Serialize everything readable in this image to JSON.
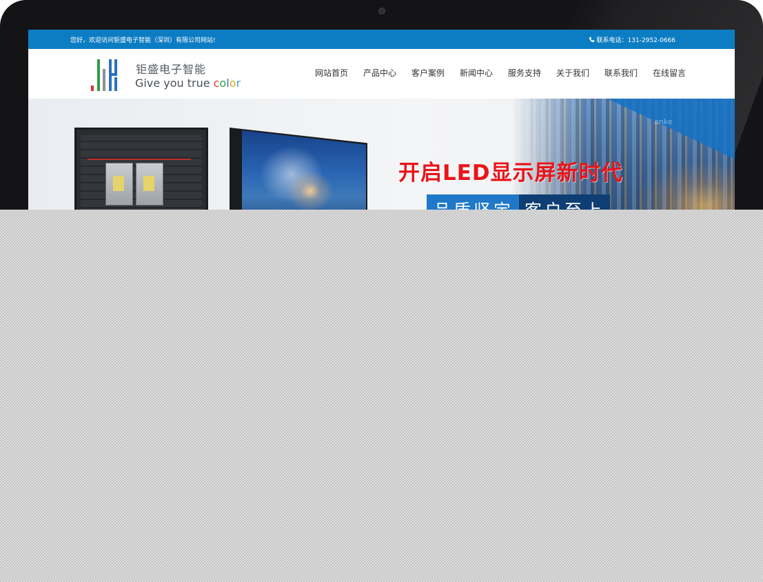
{
  "topbar": {
    "welcome": "您好，欢迎访问钜盛电子智能（深圳）有限公司网站!",
    "phone_label": "联系电话：131-2952-0666"
  },
  "header": {
    "brand_cn": "钜盛电子智能",
    "brand_en_prefix": "Give you true ",
    "brand_en_letters": [
      "c",
      "o",
      "l",
      "o",
      "r"
    ]
  },
  "nav": {
    "items": [
      {
        "label": "网站首页"
      },
      {
        "label": "产品中心"
      },
      {
        "label": "客户案例"
      },
      {
        "label": "新闻中心"
      },
      {
        "label": "服务支持"
      },
      {
        "label": "关于我们"
      },
      {
        "label": "联系我们"
      },
      {
        "label": "在线留言"
      }
    ]
  },
  "banner": {
    "headline": "开启LED显示屏新时代",
    "subline_a": "品质坚定",
    "subline_b": "客户至上",
    "watermark": "anke"
  },
  "colors": {
    "topbar_bg": "#0d7dc3",
    "headline_red": "#e8141a",
    "sub_blue": "#1f78c8",
    "sub_navy": "#0e3e74",
    "logo_red": "#d9382a",
    "logo_green": "#2f9e44",
    "logo_blue": "#2b6fc2"
  },
  "icons": {
    "phone": "phone-icon",
    "logo": "logo-mark-icon",
    "camera": "webcam-icon"
  }
}
